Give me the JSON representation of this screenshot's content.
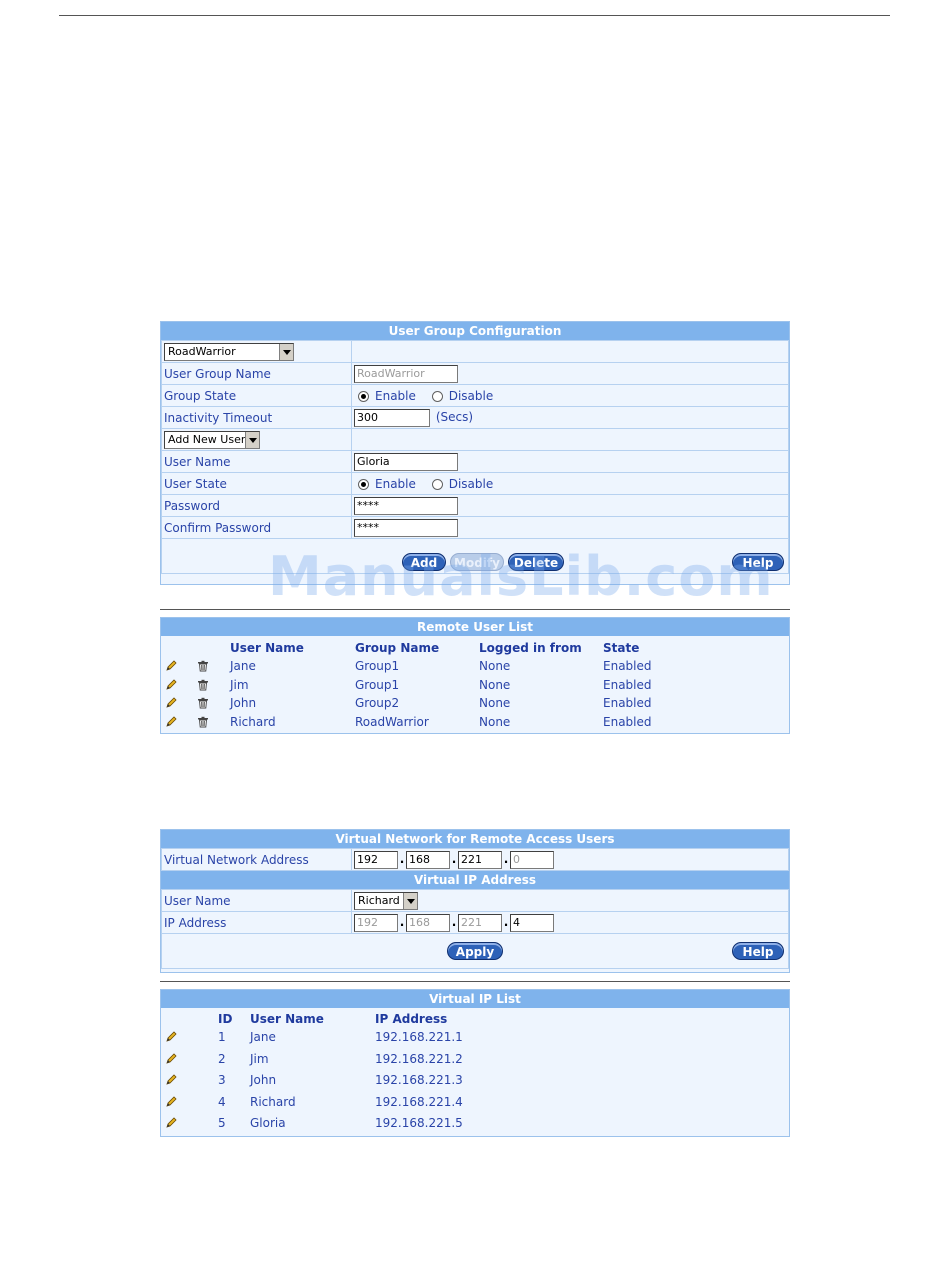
{
  "watermark": "ManualsLib.com",
  "group_config": {
    "title": "User Group Configuration",
    "group_select": "RoadWarrior",
    "group_name_label": "User Group Name",
    "group_name_value": "RoadWarrior",
    "group_state_label": "Group State",
    "enable_label": "Enable",
    "disable_label": "Disable",
    "timeout_label": "Inactivity Timeout",
    "timeout_value": "300",
    "timeout_unit": "(Secs)",
    "user_select": "Add New User",
    "user_name_label": "User Name",
    "user_name_value": "Gloria",
    "user_state_label": "User State",
    "password_label": "Password",
    "password_value": "****",
    "confirm_label": "Confirm Password",
    "confirm_value": "****",
    "add_button": "Add",
    "modify_button": "Modify",
    "delete_button": "Delete",
    "help_button": "Help"
  },
  "remote_users": {
    "title": "Remote User List",
    "headers": [
      "User Name",
      "Group Name",
      "Logged in from",
      "State"
    ],
    "rows": [
      {
        "user": "Jane",
        "group": "Group1",
        "from": "None",
        "state": "Enabled"
      },
      {
        "user": "Jim",
        "group": "Group1",
        "from": "None",
        "state": "Enabled"
      },
      {
        "user": "John",
        "group": "Group2",
        "from": "None",
        "state": "Enabled"
      },
      {
        "user": "Richard",
        "group": "RoadWarrior",
        "from": "None",
        "state": "Enabled"
      }
    ]
  },
  "virtual_network": {
    "title": "Virtual Network for Remote Access Users",
    "address_label": "Virtual Network Address",
    "octets": [
      "192",
      "168",
      "221",
      "0"
    ],
    "vip_title": "Virtual IP Address",
    "user_label": "User Name",
    "user_select": "Richard",
    "ip_label": "IP Address",
    "ip_octets": [
      "192",
      "168",
      "221",
      "4"
    ],
    "apply_button": "Apply",
    "help_button": "Help"
  },
  "vip_list": {
    "title": "Virtual IP List",
    "headers": [
      "ID",
      "User Name",
      "IP Address"
    ],
    "rows": [
      {
        "id": "1",
        "user": "Jane",
        "ip": "192.168.221.1"
      },
      {
        "id": "2",
        "user": "Jim",
        "ip": "192.168.221.2"
      },
      {
        "id": "3",
        "user": "John",
        "ip": "192.168.221.3"
      },
      {
        "id": "4",
        "user": "Richard",
        "ip": "192.168.221.4"
      },
      {
        "id": "5",
        "user": "Gloria",
        "ip": "192.168.221.5"
      }
    ]
  }
}
